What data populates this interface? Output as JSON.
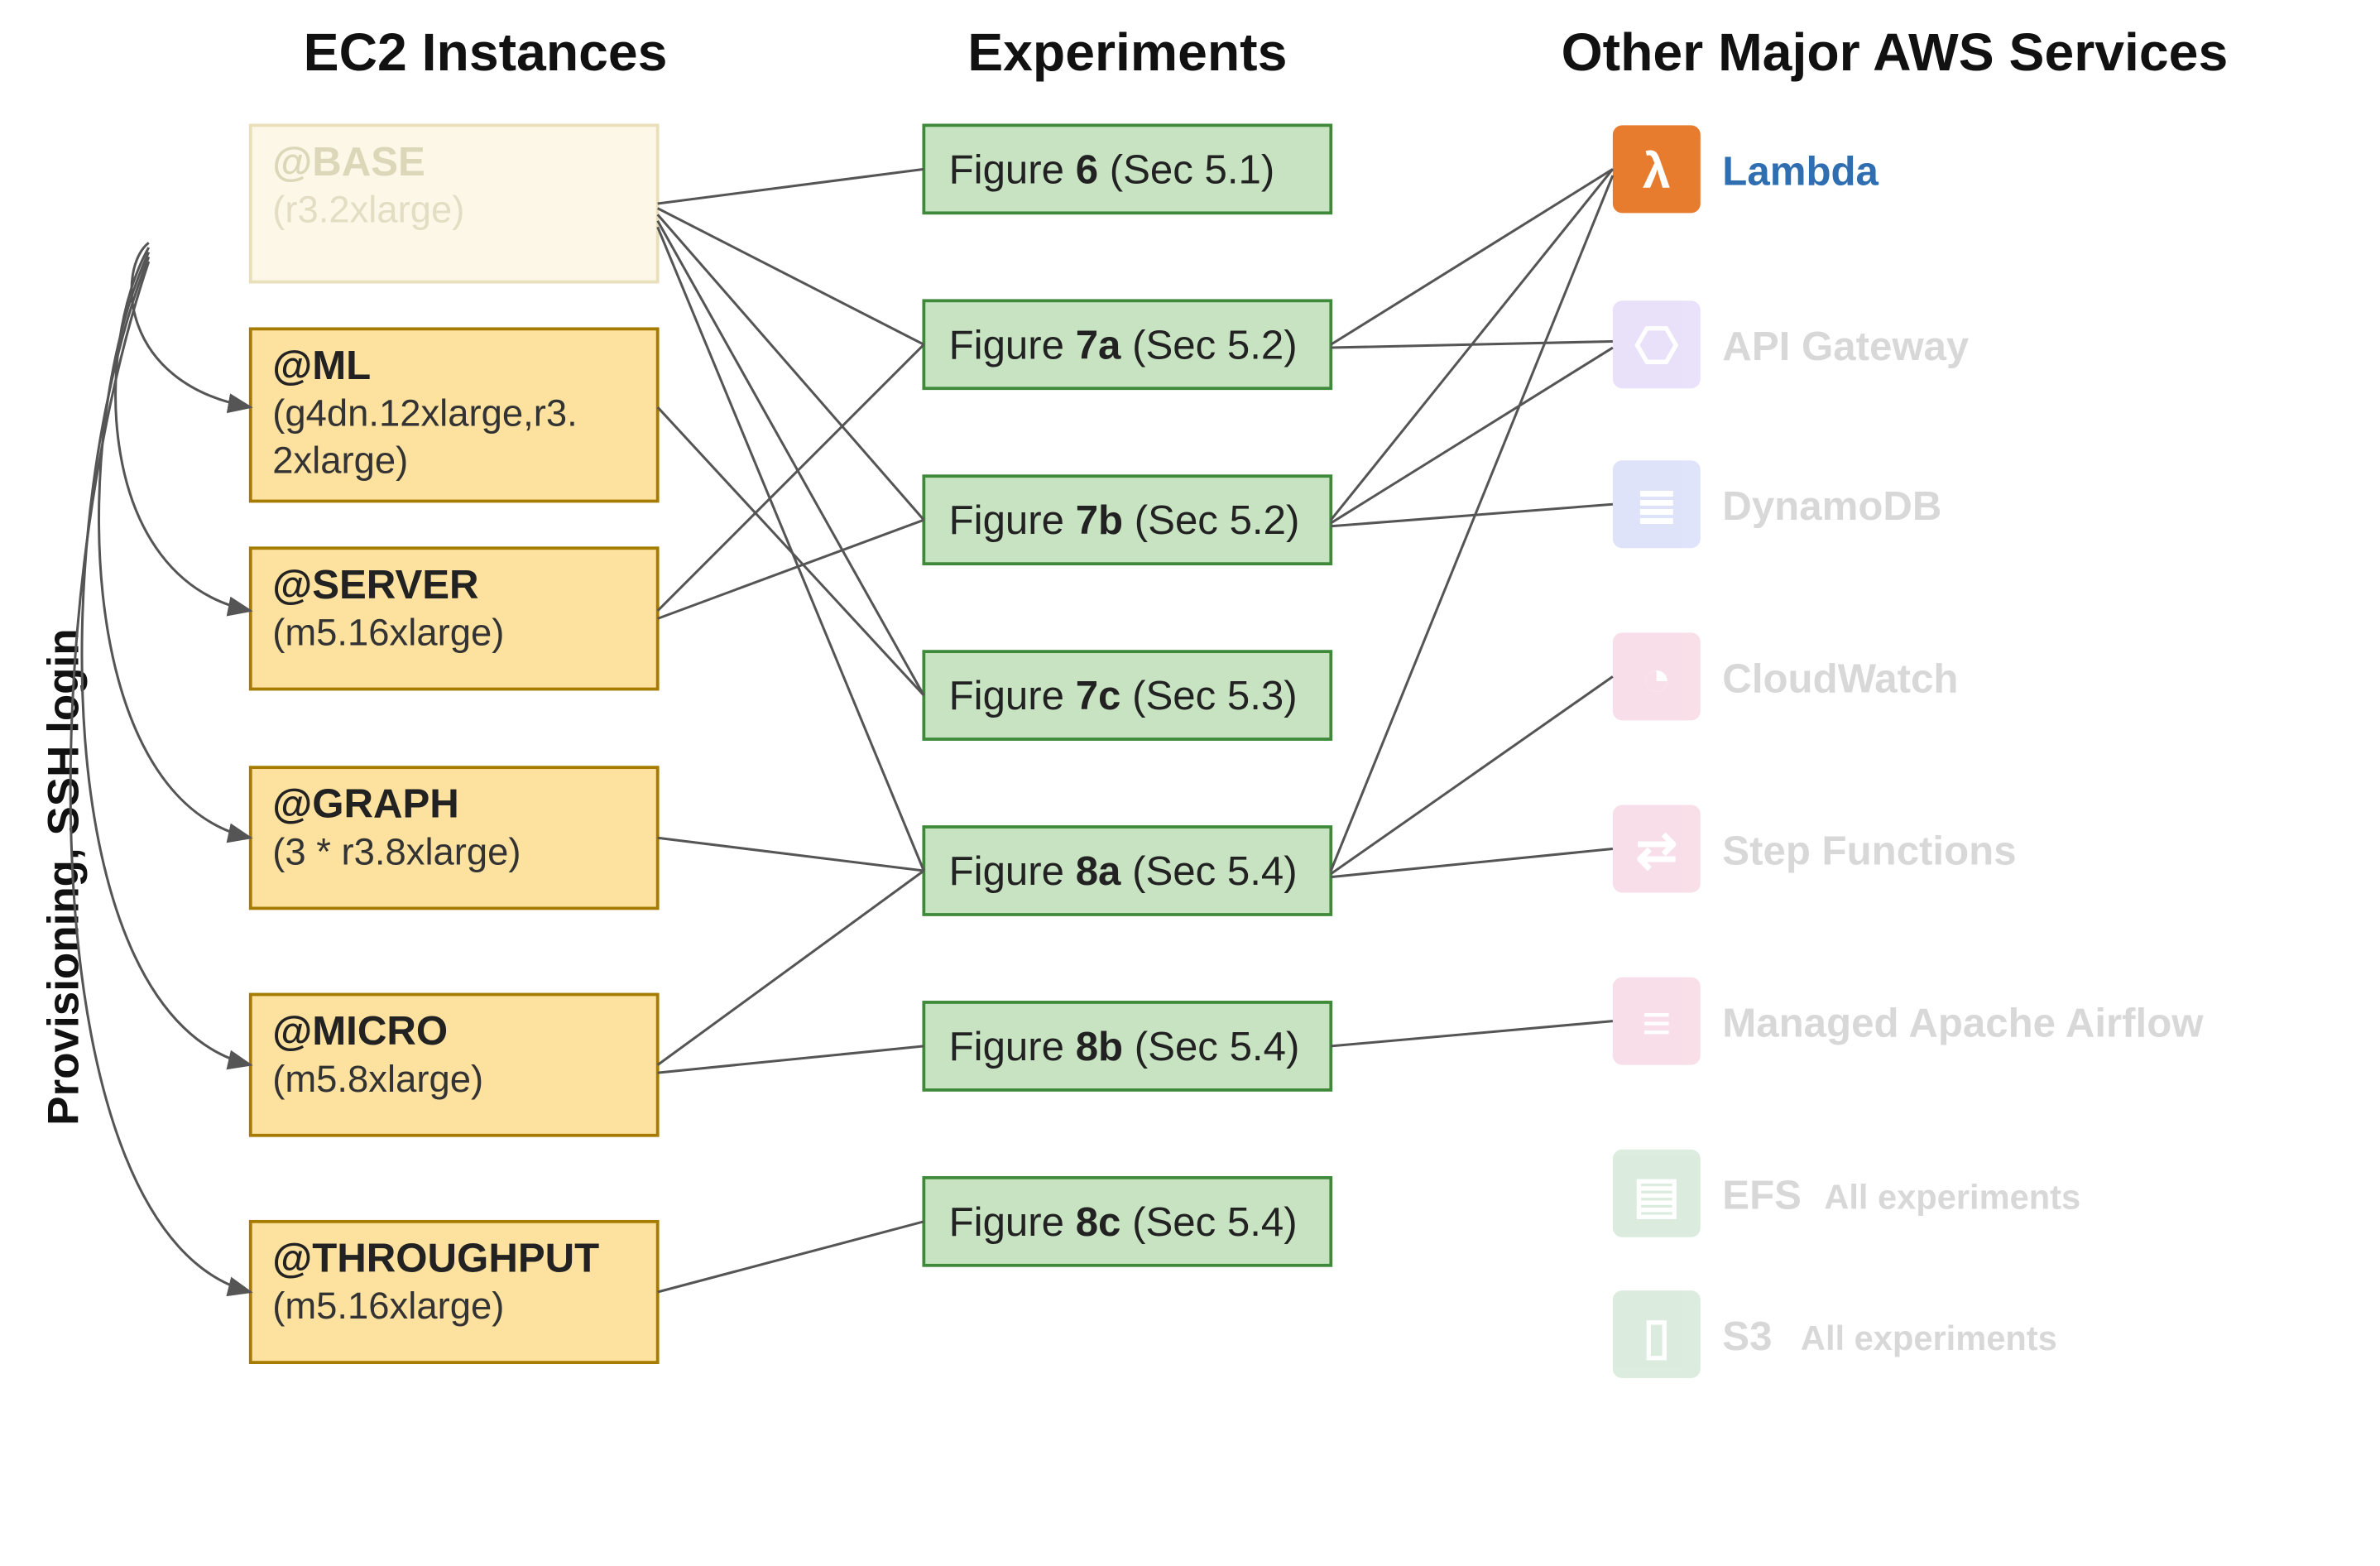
{
  "columns": {
    "ec2": "EC2 Instances",
    "experiments": "Experiments",
    "services": "Other Major AWS Services"
  },
  "side_label": "Provisioning, SSH login",
  "instances": [
    {
      "name": "@BASE",
      "sub1": "(r3.2xlarge)",
      "sub2": ""
    },
    {
      "name": "@ML",
      "sub1": "(g4dn.12xlarge,r3.",
      "sub2": "2xlarge)"
    },
    {
      "name": "@SERVER",
      "sub1": "(m5.16xlarge)",
      "sub2": ""
    },
    {
      "name": "@GRAPH",
      "sub1": "(3 * r3.8xlarge)",
      "sub2": ""
    },
    {
      "name": "@MICRO",
      "sub1": "(m5.8xlarge)",
      "sub2": ""
    },
    {
      "name": "@THROUGHPUT",
      "sub1": "(m5.16xlarge)",
      "sub2": ""
    }
  ],
  "experiments": [
    {
      "fig": "6",
      "sec": "5.1"
    },
    {
      "fig": "7a",
      "sec": "5.2"
    },
    {
      "fig": "7b",
      "sec": "5.2"
    },
    {
      "fig": "7c",
      "sec": "5.3"
    },
    {
      "fig": "8a",
      "sec": "5.4"
    },
    {
      "fig": "8b",
      "sec": "5.4"
    },
    {
      "fig": "8c",
      "sec": "5.4"
    }
  ],
  "services": [
    {
      "name": "Lambda",
      "extra": ""
    },
    {
      "name": "API Gateway",
      "extra": ""
    },
    {
      "name": "DynamoDB",
      "extra": ""
    },
    {
      "name": "CloudWatch",
      "extra": ""
    },
    {
      "name": "Step Functions",
      "extra": ""
    },
    {
      "name": "Managed Apache Airflow",
      "extra": ""
    },
    {
      "name": "EFS",
      "extra": "All experiments"
    },
    {
      "name": "S3",
      "extra": "All experiments"
    }
  ],
  "service_highlight_index": 0
}
